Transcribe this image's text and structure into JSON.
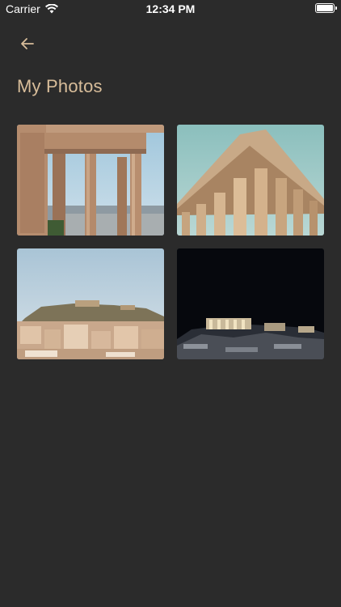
{
  "status_bar": {
    "carrier": "Carrier",
    "time": "12:34 PM",
    "wifi_icon": "wifi-icon",
    "battery_icon": "battery-icon"
  },
  "nav": {
    "back_icon": "arrow-left-icon",
    "accent_color": "#d8bd9a"
  },
  "title": "My Photos",
  "photos": [
    {
      "subject": "acropolis-porch-columns"
    },
    {
      "subject": "parthenon-columns"
    },
    {
      "subject": "acropolis-city-view"
    },
    {
      "subject": "acropolis-at-night"
    }
  ],
  "colors": {
    "background": "#2b2b2b",
    "title": "#d8bd9a",
    "status_text": "#ffffff"
  }
}
